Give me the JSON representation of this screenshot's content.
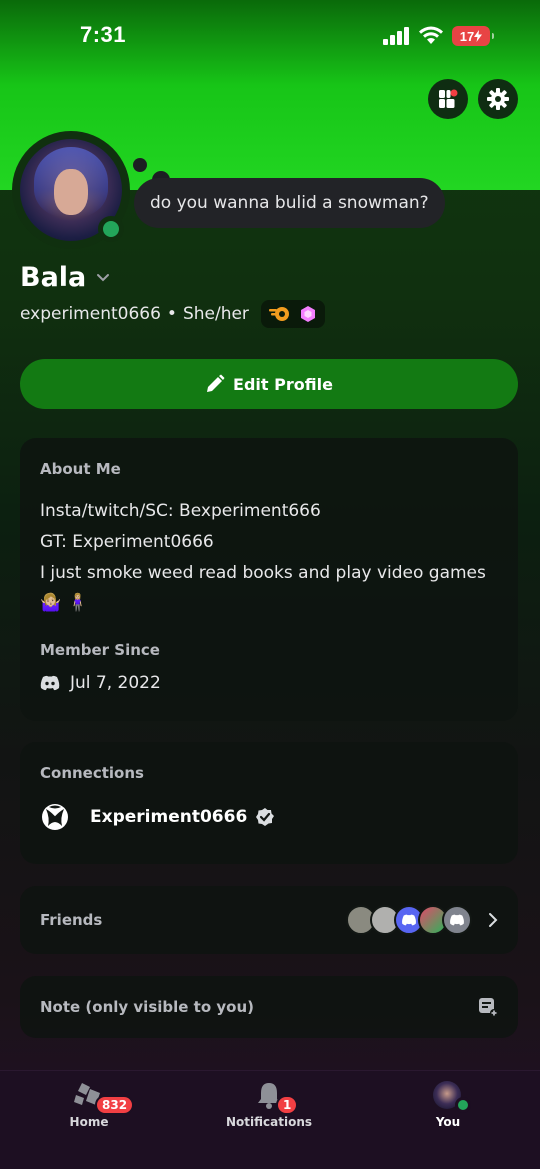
{
  "status_bar": {
    "time": "7:31",
    "battery": "17"
  },
  "profile": {
    "status_bubble": "do you wanna bulid a snowman?",
    "display_name": "Bala",
    "username": "experiment0666",
    "separator": "•",
    "pronouns": "She/her"
  },
  "edit_profile_label": "Edit Profile",
  "about": {
    "title": "About Me",
    "lines": [
      "Insta/twitch/SC: Bexperiment666",
      "GT: Experiment0666",
      "I just smoke weed read books and play video games"
    ],
    "emojis": [
      "🤷🏼‍♀️",
      "🧍🏼‍♀️"
    ],
    "member_since_title": "Member Since",
    "member_since_date": "Jul 7, 2022"
  },
  "connections": {
    "title": "Connections",
    "xbox_account": "Experiment0666"
  },
  "friends": {
    "title": "Friends"
  },
  "note": {
    "placeholder": "Note (only visible to you)"
  },
  "tabbar": {
    "home_label": "Home",
    "home_badge": "832",
    "notifications_label": "Notifications",
    "notifications_badge": "1",
    "you_label": "You"
  },
  "colors": {
    "banner": "#22d622",
    "accent_button": "#137a13",
    "online": "#23a55a",
    "badge": "#f23f43"
  }
}
